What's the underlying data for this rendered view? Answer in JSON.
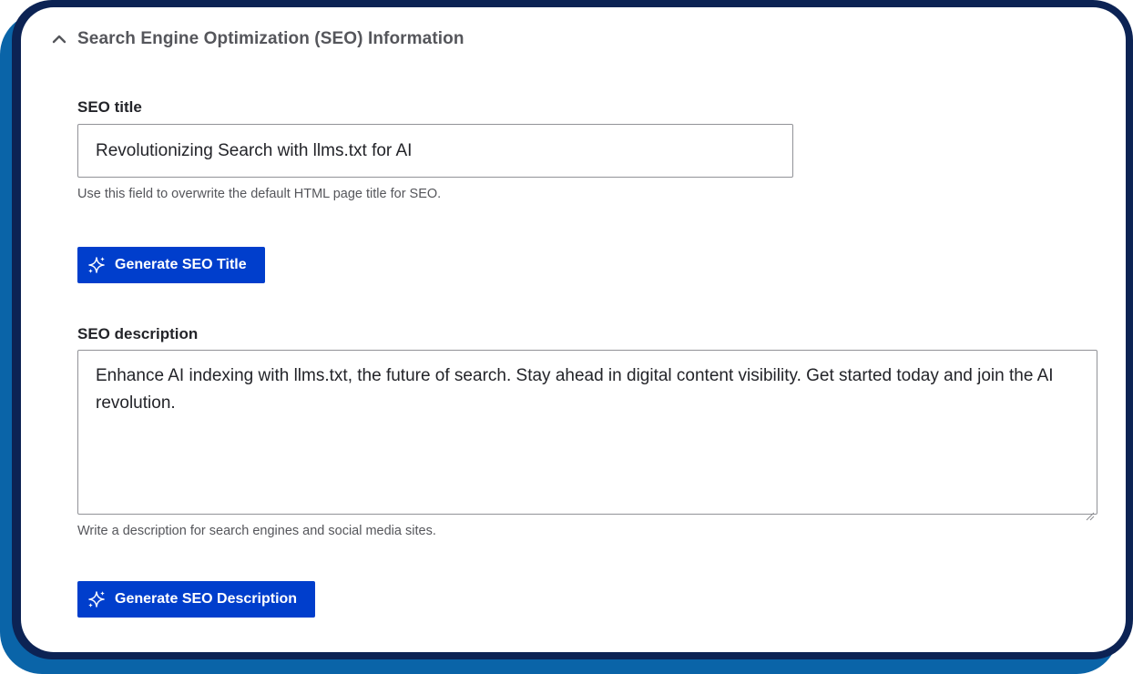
{
  "section": {
    "title": "Search Engine Optimization (SEO) Information",
    "toggle_icon": "chevron-up-icon"
  },
  "seo_title": {
    "label": "SEO title",
    "value": "Revolutionizing Search with llms.txt for AI",
    "help": "Use this field to overwrite the default HTML page title for SEO.",
    "button_label": "Generate SEO Title",
    "button_icon": "sparkle-icon"
  },
  "seo_description": {
    "label": "SEO description",
    "value": "Enhance AI indexing with llms.txt, the future of search. Stay ahead in digital content visibility. Get started today and join the AI revolution.",
    "help": "Write a description for search engines and social media sites.",
    "button_label": "Generate SEO Description",
    "button_icon": "sparkle-icon"
  },
  "colors": {
    "button": "#003ecc",
    "frame_navy": "#0c2354",
    "frame_blue": "#0a64a8"
  }
}
